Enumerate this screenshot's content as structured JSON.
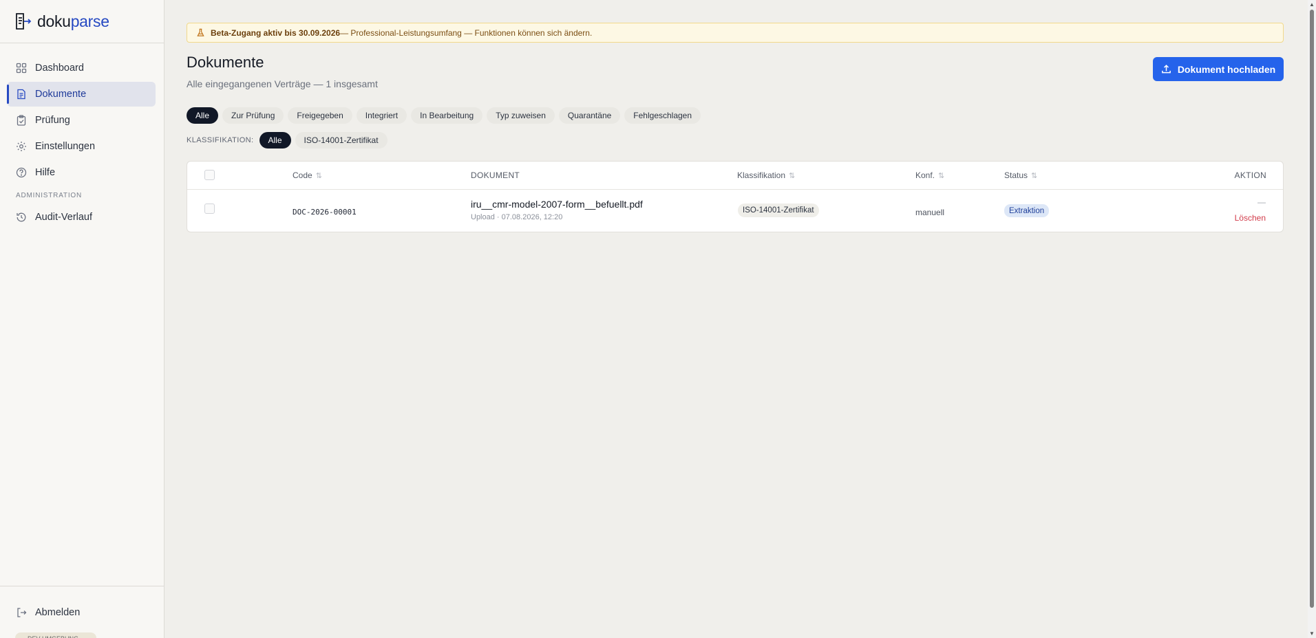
{
  "brand": {
    "name_a": "doku",
    "name_b": "parse"
  },
  "sidebar": {
    "items": [
      {
        "label": "Dashboard",
        "icon": "grid-icon"
      },
      {
        "label": "Dokumente",
        "icon": "document-icon"
      },
      {
        "label": "Prüfung",
        "icon": "clipboard-icon"
      },
      {
        "label": "Einstellungen",
        "icon": "gear-icon"
      },
      {
        "label": "Hilfe",
        "icon": "help-icon"
      }
    ],
    "admin_section": "ADMINISTRATION",
    "admin_items": [
      {
        "label": "Audit-Verlauf",
        "icon": "history-icon"
      }
    ],
    "logout": "Abmelden",
    "env_badge": "DEV UMGEBUNG"
  },
  "banner": {
    "bold": "Beta-Zugang aktiv bis 30.09.2026",
    "rest": " — Professional-Leistungsumfang — Funktionen können sich ändern."
  },
  "header": {
    "title": "Dokumente",
    "subtitle": "Alle eingegangenen Verträge — 1 insgesamt",
    "upload_label": "Dokument hochladen"
  },
  "filters": {
    "status": [
      "Alle",
      "Zur Prüfung",
      "Freigegeben",
      "Integriert",
      "In Bearbeitung",
      "Typ zuweisen",
      "Quarantäne",
      "Fehlgeschlagen"
    ],
    "status_active": "Alle",
    "class_label": "KLASSIFIKATION:",
    "classes": [
      "Alle",
      "ISO-14001-Zertifikat"
    ],
    "class_active": "Alle"
  },
  "table": {
    "headers": {
      "code": "Code",
      "document": "DOKUMENT",
      "classification": "Klassifikation",
      "confidence": "Konf.",
      "status": "Status",
      "action": "AKTION"
    },
    "rows": [
      {
        "code": "DOC-2026-00001",
        "name": "iru__cmr-model-2007-form__befuellt.pdf",
        "meta": "Upload · 07.08.2026, 12:20",
        "classification": "ISO-14001-Zertifikat",
        "confidence": "manuell",
        "status": "Extraktion",
        "action_placeholder": "—",
        "delete": "Löschen"
      }
    ]
  },
  "colors": {
    "accent": "#2563eb",
    "brand": "#2649c2",
    "danger": "#d23b4a"
  }
}
